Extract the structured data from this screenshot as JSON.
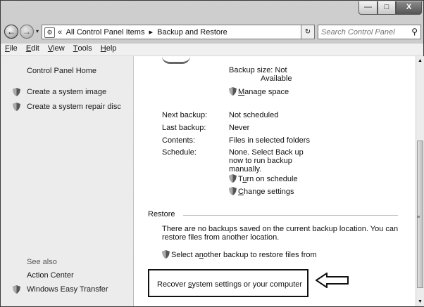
{
  "window": {
    "controls": {
      "minimize": "—",
      "maximize": "□",
      "close": "X"
    }
  },
  "nav": {
    "back_icon": "back-arrow-icon",
    "forward_icon": "forward-arrow-icon",
    "history": "▾"
  },
  "address": {
    "overflow": "«",
    "crumbs": [
      "All Control Panel Items",
      "▸",
      "Backup and Restore"
    ],
    "dropdown": "▾",
    "refresh": "↻"
  },
  "search": {
    "placeholder": "Search Control Panel",
    "icon": "search-icon"
  },
  "menu": [
    {
      "key": "F",
      "rest": "ile"
    },
    {
      "key": "E",
      "rest": "dit"
    },
    {
      "key": "V",
      "rest": "iew"
    },
    {
      "key": "T",
      "rest": "ools"
    },
    {
      "key": "H",
      "rest": "elp"
    }
  ],
  "sidebar": {
    "home": "Control Panel Home",
    "tasks": [
      "Create a system image",
      "Create a system repair disc"
    ],
    "see_also": "See also",
    "related": [
      "Action Center",
      "Windows Easy Transfer"
    ]
  },
  "backup": {
    "size_label": "Backup size: Not",
    "size_label_2": "Available",
    "manage_pre": "",
    "manage_key": "M",
    "manage_rest": "anage space",
    "next_label": "Next backup:",
    "next_value": "Not scheduled",
    "last_label": "Last backup:",
    "last_value": "Never",
    "contents_label": "Contents:",
    "contents_value": "Files in selected folders",
    "schedule_label": "Schedule:",
    "schedule_lines": [
      "None. Select Back up",
      "now to run backup",
      "manually."
    ],
    "turn_pre": "T",
    "turn_key": "u",
    "turn_rest": "rn on schedule",
    "change_pre": "",
    "change_key": "C",
    "change_rest": "hange settings"
  },
  "restore": {
    "heading": "Restore",
    "message_1": "There are no backups saved on the current backup location. You can",
    "message_2": "restore files from another location.",
    "select_pre": "Select a",
    "select_key": "n",
    "select_rest": "other backup to restore files from",
    "recover_pre": "Recover ",
    "recover_key": "s",
    "recover_rest": "ystem settings or your computer"
  },
  "scrollbar": {
    "up": "▲",
    "down": "▼",
    "grip": "≡"
  }
}
